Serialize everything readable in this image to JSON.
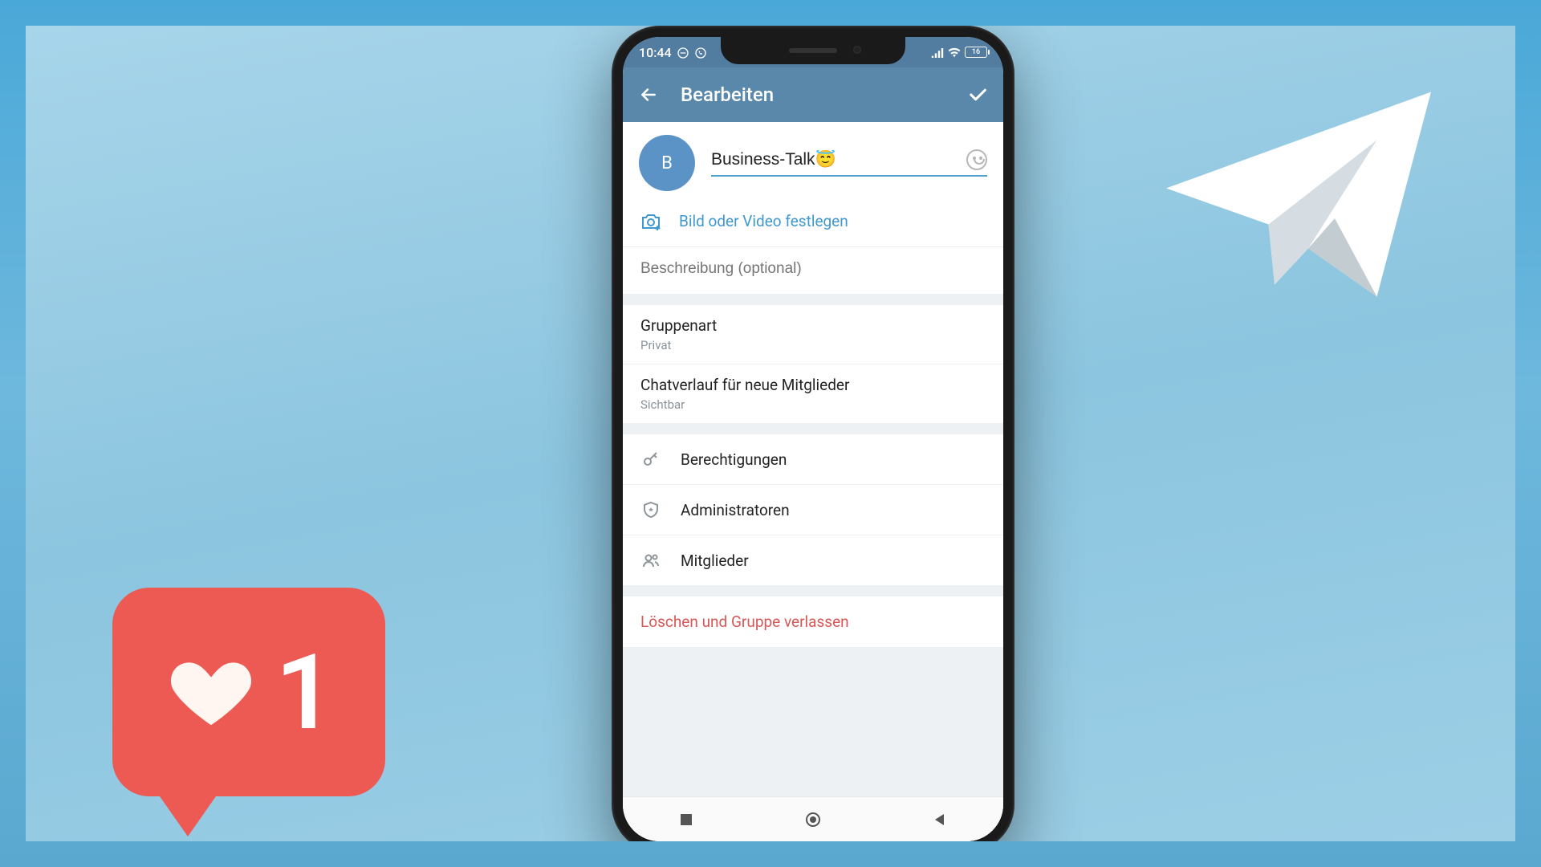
{
  "statusbar": {
    "time": "10:44",
    "battery": "16"
  },
  "header": {
    "title": "Bearbeiten"
  },
  "profile": {
    "avatar_letter": "B",
    "group_name": "Business-Talk😇",
    "set_photo_label": "Bild oder Video festlegen",
    "description_placeholder": "Beschreibung (optional)"
  },
  "settings": {
    "group_type": {
      "label": "Gruppenart",
      "value": "Privat"
    },
    "chat_history": {
      "label": "Chatverlauf für neue Mitglieder",
      "value": "Sichtbar"
    }
  },
  "management": {
    "permissions": "Berechtigungen",
    "administrators": "Administratoren",
    "members": "Mitglieder"
  },
  "danger": {
    "delete_leave": "Löschen und Gruppe verlassen"
  },
  "overlay": {
    "like_count": "1"
  }
}
